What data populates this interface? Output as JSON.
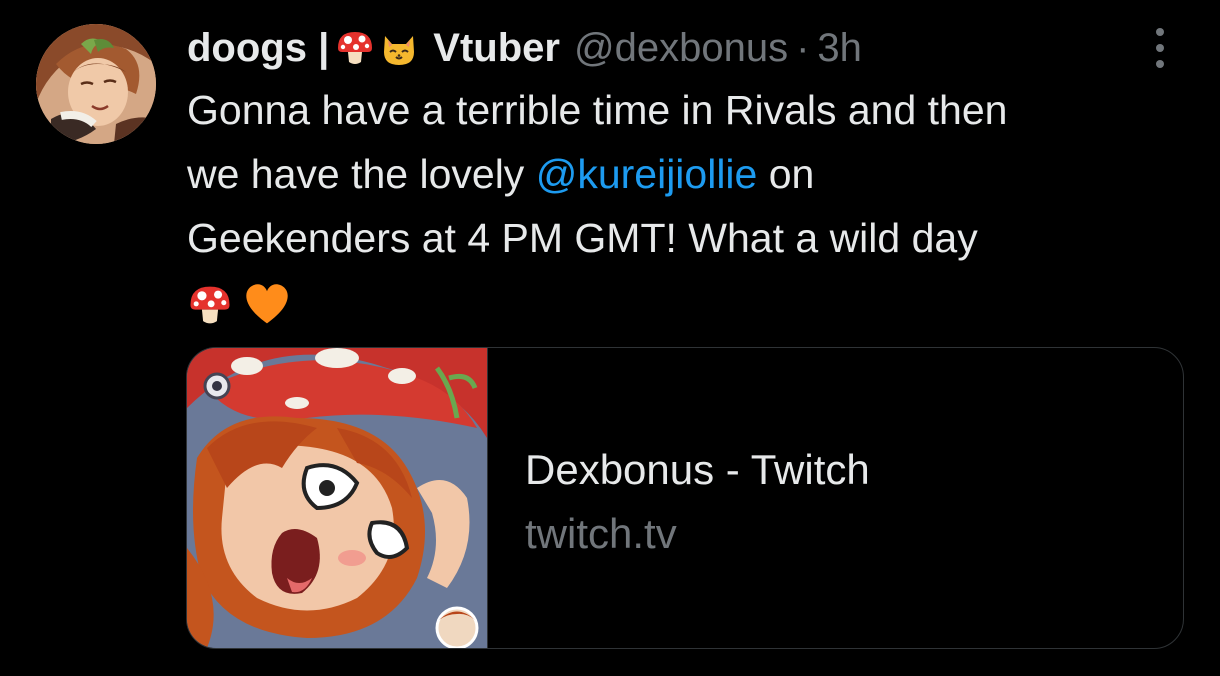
{
  "tweet": {
    "author": {
      "name_prefix": "doogs |",
      "name_suffix": "Vtuber",
      "name_emojis": [
        "mushroom-emoji",
        "cat-face-emoji"
      ],
      "handle": "@dexbonus",
      "separator": "·",
      "timestamp": "3h",
      "avatar_icon": "avatar-illustration"
    },
    "text": {
      "line1": "Gonna have a terrible time in Rivals and then",
      "line2_before": "we have the lovely ",
      "mention": "@kureijiollie",
      "line2_after": " on",
      "line3": "Geekenders at 4 PM GMT! What a wild day",
      "trailing_emojis": [
        "mushroom-emoji",
        "orange-heart-emoji"
      ]
    },
    "card": {
      "title": "Dexbonus - Twitch",
      "domain": "twitch.tv",
      "thumbnail_icon": "card-thumbnail-illustration"
    },
    "more_icon": "more-options-icon"
  },
  "colors": {
    "background": "#000000",
    "primary_text": "#e7e9ea",
    "secondary_text": "#71767b",
    "link": "#1d9bf0",
    "border": "#2f3336",
    "heart": "#ff8c1a",
    "mushroom_cap": "#e5322d"
  }
}
